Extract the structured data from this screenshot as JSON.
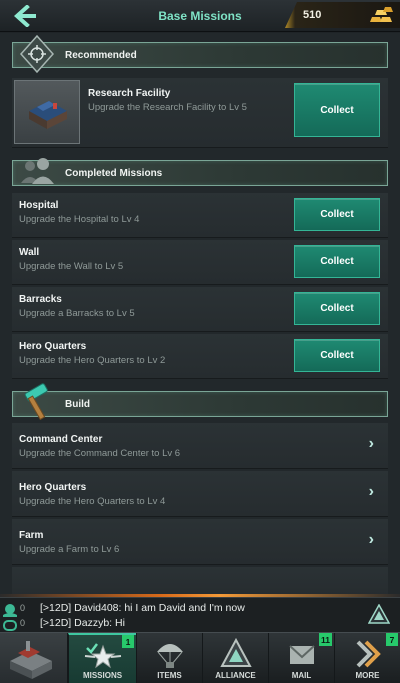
{
  "header": {
    "title": "Base Missions",
    "gold": "510"
  },
  "recommended": {
    "section_title": "Recommended",
    "item": {
      "title": "Research Facility",
      "desc": "Upgrade the Research Facility to Lv 5",
      "button": "Collect"
    }
  },
  "completed": {
    "section_title": "Completed Missions",
    "items": [
      {
        "title": "Hospital",
        "desc": "Upgrade the Hospital to Lv 4",
        "button": "Collect"
      },
      {
        "title": "Wall",
        "desc": "Upgrade the Wall to Lv 5",
        "button": "Collect"
      },
      {
        "title": "Barracks",
        "desc": "Upgrade a Barracks to Lv 5",
        "button": "Collect"
      },
      {
        "title": "Hero Quarters",
        "desc": "Upgrade the Hero Quarters to Lv 2",
        "button": "Collect"
      }
    ]
  },
  "build": {
    "section_title": "Build",
    "items": [
      {
        "title": "Command Center",
        "desc": "Upgrade the Command Center to Lv 6"
      },
      {
        "title": "Hero Quarters",
        "desc": "Upgrade the Hero Quarters to Lv 4"
      },
      {
        "title": "Farm",
        "desc": "Upgrade a Farm to Lv 6"
      }
    ]
  },
  "chat": {
    "lines": [
      {
        "count": "0",
        "text": "[>12D] David408: hi I am David and I'm now"
      },
      {
        "count": "0",
        "text": "[>12D] Dazzyb: Hi"
      }
    ]
  },
  "nav": {
    "tabs": [
      {
        "label": "MISSIONS",
        "badge": "1",
        "icon": "missions-star-icon"
      },
      {
        "label": "ITEMS",
        "badge": "",
        "icon": "parachute-icon"
      },
      {
        "label": "ALLIANCE",
        "badge": "",
        "icon": "alliance-triangle-icon"
      },
      {
        "label": "MAIL",
        "badge": "11",
        "icon": "mail-icon"
      },
      {
        "label": "MORE",
        "badge": "7",
        "icon": "chevron-right-icon"
      }
    ]
  },
  "colors": {
    "accent": "#7fe3c6",
    "button": "#1f8a72",
    "badge": "#27c96b",
    "gold": "#b08a28"
  }
}
